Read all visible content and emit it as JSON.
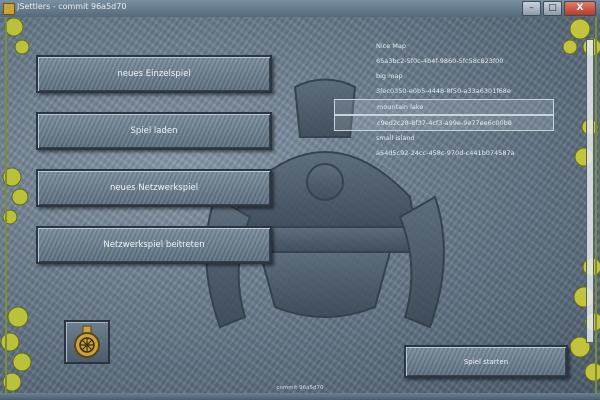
{
  "window": {
    "title": "JSettlers - commit 96a5d70",
    "minimize_glyph": "–",
    "maximize_glyph": "□",
    "close_glyph": "X"
  },
  "menu": {
    "new_single": "neues Einzelspiel",
    "load_game": "Spiel laden",
    "new_network": "neues Netzwerkspiel",
    "join_network": "Netzwerkspiel beitreten"
  },
  "maps": [
    {
      "name": "Nice Map",
      "id": "65a3bc2-5f0c-4b4f-9860-5fc58c823f00"
    },
    {
      "name": "big map",
      "id": "3fec0350-e0b5-4448-8f50-a33a6301f68e"
    },
    {
      "name": "mountain lake",
      "id": "c9ed2c28-8f37-4cf3-a99e-9e77ee6c00b8"
    },
    {
      "name": "small island",
      "id": "a54d5c92-24cc-458c-970d-c441b074587a"
    }
  ],
  "selected_map": "mountain lake",
  "start_button": "Spiel starten",
  "status_text": "commit 96a5d70",
  "emblem_icon": "gold-medal-icon",
  "colors": {
    "stone": "#6e7f90",
    "accent_gold": "#c9a43a",
    "text": "#f0f4f7"
  }
}
